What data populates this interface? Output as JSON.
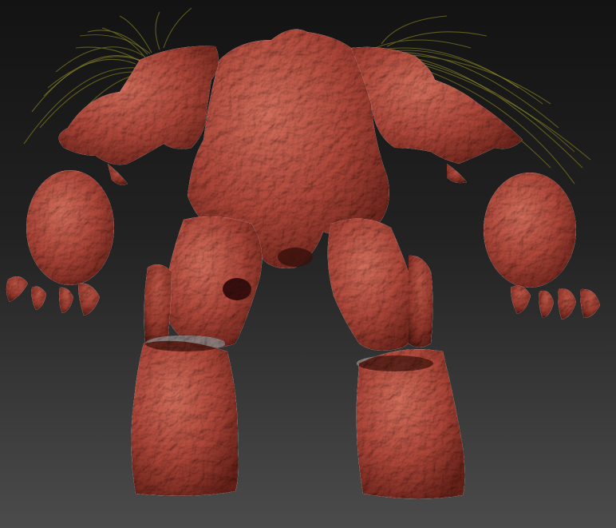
{
  "scene": {
    "subject": "rock-golem-sculpt",
    "background_top": "#151515",
    "background_bottom": "#4a4a4a",
    "material_color": "#b0473a",
    "material_highlight": "#d9715f",
    "material_shadow": "#5a1c15",
    "fur_color": "#6f6a1e",
    "fur_highlight": "#a8a03a"
  }
}
